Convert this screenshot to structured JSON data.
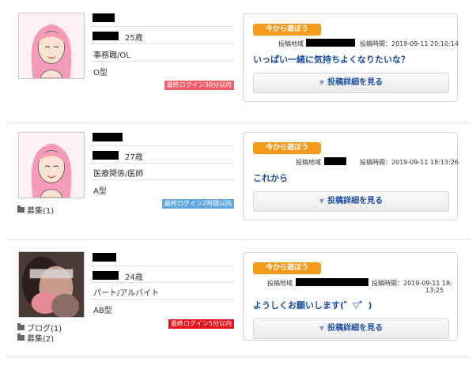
{
  "profiles": [
    {
      "age": "25歳",
      "job": "事務職/OL",
      "blood": "O型",
      "login_badge": "最終ログイン30分以内",
      "badge_color": "#f45d6a",
      "side_links": [],
      "post": {
        "tag": "今から遊ぼう",
        "location_label": "投稿地域",
        "time_label": "投稿時間：2019-09-11 20:10:14",
        "title": "いっぱい一緒に気持ちよくなりたいな？",
        "button": "投稿詳細を見る"
      }
    },
    {
      "age": "27歳",
      "job": "医療関係/医師",
      "blood": "A型",
      "login_badge": "最終ログイン2時間以内",
      "badge_color": "#5fa9e0",
      "side_links": [
        "募集(1)"
      ],
      "post": {
        "tag": "今から遊ぼう",
        "location_label": "投稿地域",
        "time_label": "投稿時間：2019-09-11 18:13:26",
        "title": "これから",
        "button": "投稿詳細を見る"
      }
    },
    {
      "age": "24歳",
      "job": "パート/アルバイト",
      "blood": "AB型",
      "login_badge": "最終ログイン5分以内",
      "badge_color": "#e8151b",
      "side_links": [
        "ブログ(1)",
        "募集(2)"
      ],
      "post": {
        "tag": "今から遊ぼう",
        "location_label": "投稿地域",
        "time_label": "投稿時間：2019-09-11 18:",
        "time_label_2": "13:25",
        "title": "ようしくお願いします(゜▽゜)",
        "button": "投稿詳細を見る"
      }
    }
  ],
  "icons": {
    "folder": "folder-icon",
    "arrow": "down-arrow-icon",
    "avatar_placeholder": "pink-hair-avatar-icon"
  }
}
